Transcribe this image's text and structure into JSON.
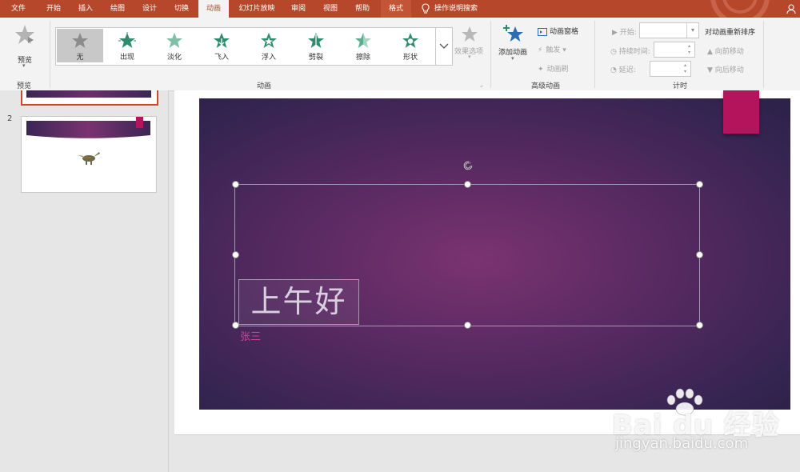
{
  "tabs": [
    {
      "label": "文件",
      "state": "normal"
    },
    {
      "label": "开始",
      "state": "normal"
    },
    {
      "label": "插入",
      "state": "normal"
    },
    {
      "label": "绘图",
      "state": "normal"
    },
    {
      "label": "设计",
      "state": "normal"
    },
    {
      "label": "切换",
      "state": "normal"
    },
    {
      "label": "动画",
      "state": "active"
    },
    {
      "label": "幻灯片放映",
      "state": "normal"
    },
    {
      "label": "审阅",
      "state": "normal"
    },
    {
      "label": "视图",
      "state": "normal"
    },
    {
      "label": "帮助",
      "state": "normal"
    },
    {
      "label": "格式",
      "state": "contextual"
    }
  ],
  "tell_me": "操作说明搜索",
  "ribbon": {
    "preview": {
      "button": "预览",
      "group": "预览"
    },
    "animations": {
      "group": "动画",
      "items": [
        "无",
        "出现",
        "淡化",
        "飞入",
        "浮入",
        "劈裂",
        "擦除",
        "形状"
      ],
      "selected": "无",
      "effect_options": "效果选项"
    },
    "advanced": {
      "group": "高级动画",
      "add_animation": "添加动画",
      "animation_pane": "动画窗格",
      "trigger": "触发",
      "painter": "动画刷"
    },
    "timing": {
      "group": "计时",
      "start": "开始:",
      "duration": "持续时间:",
      "delay": "延迟:",
      "reorder": "对动画重新排序",
      "move_earlier": "向前移动",
      "move_later": "向后移动"
    }
  },
  "thumbnails": {
    "slide2_number": "2"
  },
  "slide": {
    "title": "上午好",
    "subtitle": "张三"
  },
  "watermark": {
    "brand": "Bai du 经验",
    "url": "jingyan.baidu.com"
  },
  "colors": {
    "tab_bar": "#b7472a",
    "slide_tag": "#b4145c",
    "subtitle": "#d0419a",
    "star": "#2e8b6e"
  }
}
